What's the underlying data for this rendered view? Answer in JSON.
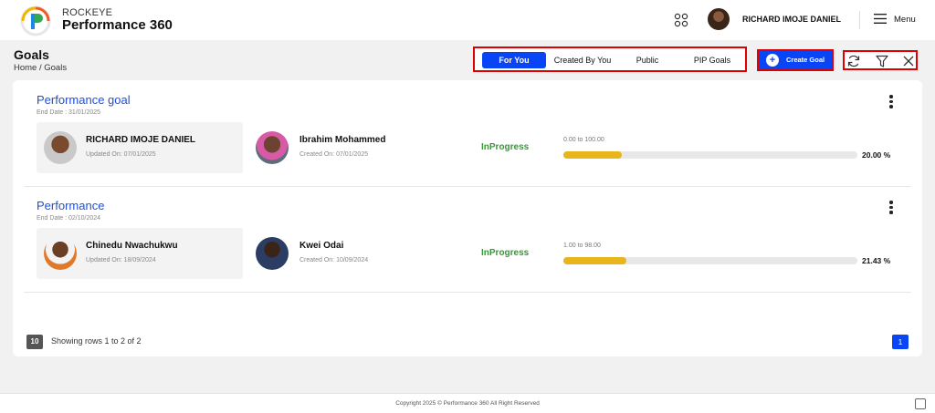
{
  "app": {
    "brand_top": "ROCKEYE",
    "brand_main": "Performance 360"
  },
  "header": {
    "user_name": "RICHARD IMOJE DANIEL",
    "menu_label": "Menu"
  },
  "page": {
    "title": "Goals",
    "breadcrumb": "Home  /  Goals"
  },
  "tabs": [
    {
      "label": "For You",
      "active": true
    },
    {
      "label": "Created By You",
      "active": false
    },
    {
      "label": "Public",
      "active": false
    },
    {
      "label": "PIP Goals",
      "active": false
    }
  ],
  "create_goal_label": "Create Goal",
  "goals": [
    {
      "title": "Performance goal",
      "end_date": "End Date : 31/01/2025",
      "owner": {
        "name": "RICHARD IMOJE DANIEL",
        "sub": "Updated On: 07/01/2025"
      },
      "creator": {
        "name": "Ibrahim Mohammed",
        "sub": "Created On: 07/01/2025"
      },
      "status": "InProgress",
      "range": "0.00 to 100.00",
      "progress": 20.0,
      "progress_label": "20.00 %"
    },
    {
      "title": "Performance",
      "end_date": "End Date : 02/10/2024",
      "owner": {
        "name": "Chinedu Nwachukwu",
        "sub": "Updated On: 18/09/2024"
      },
      "creator": {
        "name": "Kwei Odai",
        "sub": "Created On: 10/09/2024"
      },
      "status": "InProgress",
      "range": "1.00 to 98.00",
      "progress": 21.43,
      "progress_label": "21.43 %"
    }
  ],
  "pagination": {
    "page_size": "10",
    "showing": "Showing rows 1 to 2 of 2",
    "current_page": "1"
  },
  "footer": {
    "copyright": "Copyright 2025 © Performance 360 All Right Reserved"
  },
  "colors": {
    "accent": "#0a45f5",
    "status_green": "#2e9e2e",
    "progress_fill": "#e8b51d",
    "highlight_border": "#e00000"
  }
}
